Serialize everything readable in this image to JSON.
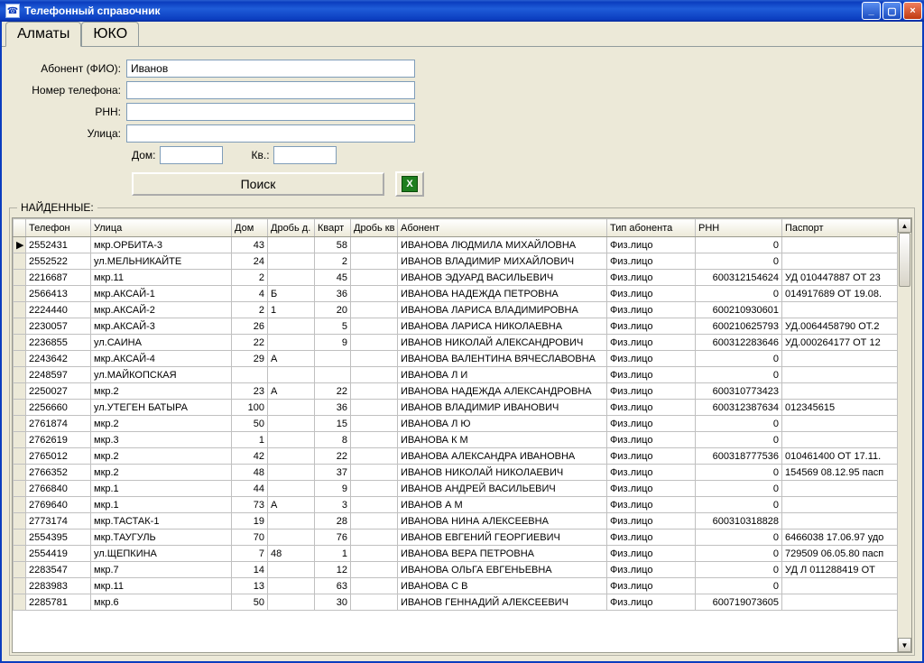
{
  "window": {
    "title": "Телефонный справочник"
  },
  "tabs": [
    {
      "label": "Алматы",
      "active": true
    },
    {
      "label": "ЮКО",
      "active": false
    }
  ],
  "form": {
    "labels": {
      "abonent": "Абонент (ФИО):",
      "phone": "Номер телефона:",
      "rnn": "РНН:",
      "street": "Улица:",
      "house": "Дом:",
      "kv": "Кв.:"
    },
    "values": {
      "abonent": "Иванов",
      "phone": "",
      "rnn": "",
      "street": "",
      "house": "",
      "kv": ""
    },
    "search_label": "Поиск"
  },
  "found_label": "НАЙДЕННЫЕ:",
  "columns": [
    "Телефон",
    "Улица",
    "Дом",
    "Дробь д.",
    "Кварт",
    "Дробь кв",
    "Абонент",
    "Тип абонента",
    "РНН",
    "Паспорт"
  ],
  "rows": [
    {
      "phone": "2552431",
      "street": "мкр.ОРБИТА-3",
      "house": "43",
      "frac": "",
      "kv": "58",
      "frack": "",
      "abon": "ИВАНОВА ЛЮДМИЛА МИХАЙЛОВНА",
      "type": "Физ.лицо",
      "rnn": "0",
      "pass": ""
    },
    {
      "phone": "2552522",
      "street": "ул.МЕЛЬНИКАЙТЕ",
      "house": "24",
      "frac": "",
      "kv": "2",
      "frack": "",
      "abon": "ИВАНОВ ВЛАДИМИР МИХАЙЛОВИЧ",
      "type": "Физ.лицо",
      "rnn": "0",
      "pass": ""
    },
    {
      "phone": "2216687",
      "street": "мкр.11",
      "house": "2",
      "frac": "",
      "kv": "45",
      "frack": "",
      "abon": "ИВАНОВ ЭДУАРД ВАСИЛЬЕВИЧ",
      "type": "Физ.лицо",
      "rnn": "600312154624",
      "pass": "УД 010447887 ОТ 23"
    },
    {
      "phone": "2566413",
      "street": "мкр.АКСАЙ-1",
      "house": "4",
      "frac": "Б",
      "kv": "36",
      "frack": "",
      "abon": "ИВАНОВА НАДЕЖДА ПЕТРОВНА",
      "type": "Физ.лицо",
      "rnn": "0",
      "pass": "014917689 ОТ 19.08."
    },
    {
      "phone": "2224440",
      "street": "мкр.АКСАЙ-2",
      "house": "2",
      "frac": "1",
      "kv": "20",
      "frack": "",
      "abon": "ИВАНОВА ЛАРИСА ВЛАДИМИРОВНА",
      "type": "Физ.лицо",
      "rnn": "600210930601",
      "pass": ""
    },
    {
      "phone": "2230057",
      "street": "мкр.АКСАЙ-3",
      "house": "26",
      "frac": "",
      "kv": "5",
      "frack": "",
      "abon": "ИВАНОВА ЛАРИСА НИКОЛАЕВНА",
      "type": "Физ.лицо",
      "rnn": "600210625793",
      "pass": "УД.0064458790 ОТ.2"
    },
    {
      "phone": "2236855",
      "street": "ул.САИНА",
      "house": "22",
      "frac": "",
      "kv": "9",
      "frack": "",
      "abon": "ИВАНОВ НИКОЛАЙ АЛЕКСАНДРОВИЧ",
      "type": "Физ.лицо",
      "rnn": "600312283646",
      "pass": "УД.000264177 ОТ 12"
    },
    {
      "phone": "2243642",
      "street": "мкр.АКСАЙ-4",
      "house": "29",
      "frac": "А",
      "kv": "",
      "frack": "",
      "abon": "ИВАНОВА ВАЛЕНТИНА ВЯЧЕСЛАВОВНА",
      "type": "Физ.лицо",
      "rnn": "0",
      "pass": ""
    },
    {
      "phone": "2248597",
      "street": "ул.МАЙКОПСКАЯ",
      "house": "",
      "frac": "",
      "kv": "",
      "frack": "",
      "abon": "ИВАНОВА Л И",
      "type": "Физ.лицо",
      "rnn": "0",
      "pass": ""
    },
    {
      "phone": "2250027",
      "street": "мкр.2",
      "house": "23",
      "frac": "А",
      "kv": "22",
      "frack": "",
      "abon": "ИВАНОВА НАДЕЖДА АЛЕКСАНДРОВНА",
      "type": "Физ.лицо",
      "rnn": "600310773423",
      "pass": ""
    },
    {
      "phone": "2256660",
      "street": "ул.УТЕГЕН БАТЫРА",
      "house": "100",
      "frac": "",
      "kv": "36",
      "frack": "",
      "abon": "ИВАНОВ ВЛАДИМИР ИВАНОВИЧ",
      "type": "Физ.лицо",
      "rnn": "600312387634",
      "pass": "012345615"
    },
    {
      "phone": "2761874",
      "street": "мкр.2",
      "house": "50",
      "frac": "",
      "kv": "15",
      "frack": "",
      "abon": "ИВАНОВА Л Ю",
      "type": "Физ.лицо",
      "rnn": "0",
      "pass": ""
    },
    {
      "phone": "2762619",
      "street": "мкр.3",
      "house": "1",
      "frac": "",
      "kv": "8",
      "frack": "",
      "abon": "ИВАНОВА К М",
      "type": "Физ.лицо",
      "rnn": "0",
      "pass": ""
    },
    {
      "phone": "2765012",
      "street": "мкр.2",
      "house": "42",
      "frac": "",
      "kv": "22",
      "frack": "",
      "abon": "ИВАНОВА АЛЕКСАНДРА ИВАНОВНА",
      "type": "Физ.лицо",
      "rnn": "600318777536",
      "pass": "010461400 ОТ 17.11."
    },
    {
      "phone": "2766352",
      "street": "мкр.2",
      "house": "48",
      "frac": "",
      "kv": "37",
      "frack": "",
      "abon": "ИВАНОВ НИКОЛАЙ НИКОЛАЕВИЧ",
      "type": "Физ.лицо",
      "rnn": "0",
      "pass": "154569 08.12.95 пасп"
    },
    {
      "phone": "2766840",
      "street": "мкр.1",
      "house": "44",
      "frac": "",
      "kv": "9",
      "frack": "",
      "abon": "ИВАНОВ АНДРЕЙ ВАСИЛЬЕВИЧ",
      "type": "Физ.лицо",
      "rnn": "0",
      "pass": ""
    },
    {
      "phone": "2769640",
      "street": "мкр.1",
      "house": "73",
      "frac": "А",
      "kv": "3",
      "frack": "",
      "abon": "ИВАНОВ А М",
      "type": "Физ.лицо",
      "rnn": "0",
      "pass": ""
    },
    {
      "phone": "2773174",
      "street": "мкр.ТАСТАК-1",
      "house": "19",
      "frac": "",
      "kv": "28",
      "frack": "",
      "abon": "ИВАНОВА НИНА АЛЕКСЕЕВНА",
      "type": "Физ.лицо",
      "rnn": "600310318828",
      "pass": ""
    },
    {
      "phone": "2554395",
      "street": "мкр.ТАУГУЛЬ",
      "house": "70",
      "frac": "",
      "kv": "76",
      "frack": "",
      "abon": "ИВАНОВ ЕВГЕНИЙ ГЕОРГИЕВИЧ",
      "type": "Физ.лицо",
      "rnn": "0",
      "pass": "6466038 17.06.97 удо"
    },
    {
      "phone": "2554419",
      "street": "ул.ЩЕПКИНА",
      "house": "7",
      "frac": "48",
      "kv": "1",
      "frack": "",
      "abon": "ИВАНОВА ВЕРА ПЕТРОВНА",
      "type": "Физ.лицо",
      "rnn": "0",
      "pass": "729509 06.05.80 пасп"
    },
    {
      "phone": "2283547",
      "street": "мкр.7",
      "house": "14",
      "frac": "",
      "kv": "12",
      "frack": "",
      "abon": "ИВАНОВА ОЛЬГА ЕВГЕНЬЕВНА",
      "type": "Физ.лицо",
      "rnn": "0",
      "pass": "УД Л 011288419 ОТ"
    },
    {
      "phone": "2283983",
      "street": "мкр.11",
      "house": "13",
      "frac": "",
      "kv": "63",
      "frack": "",
      "abon": "ИВАНОВА С В",
      "type": "Физ.лицо",
      "rnn": "0",
      "pass": ""
    },
    {
      "phone": "2285781",
      "street": "мкр.6",
      "house": "50",
      "frac": "",
      "kv": "30",
      "frack": "",
      "abon": "ИВАНОВ ГЕННАДИЙ АЛЕКСЕЕВИЧ",
      "type": "Физ.лицо",
      "rnn": "600719073605",
      "pass": ""
    }
  ]
}
